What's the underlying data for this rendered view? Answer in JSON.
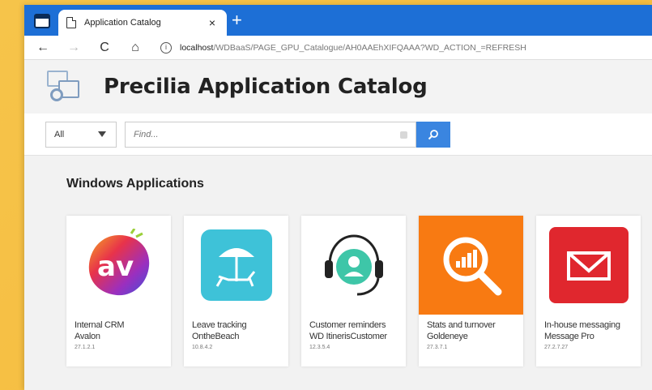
{
  "tab": {
    "title": "Application Catalog",
    "close": "×",
    "new": "+"
  },
  "toolbar": {
    "back": "←",
    "forward": "→",
    "reload": "C",
    "home": "⌂",
    "info": "i",
    "url_host": "localhost",
    "url_path": "/WDBaaS/PAGE_GPU_Catalogue/AH0AAEhXIFQAAA?WD_ACTION_=REFRESH"
  },
  "header": {
    "title": "Precilia Application Catalog"
  },
  "search": {
    "category": "All",
    "placeholder": "Find..."
  },
  "section": {
    "title": "Windows Applications"
  },
  "apps": [
    {
      "name1": "Internal CRM",
      "name2": "Avalon",
      "version": "27.1.2.1",
      "icon": "avalon-logo-icon"
    },
    {
      "name1": "Leave tracking",
      "name2": "OntheBeach",
      "version": "10.8.4.2",
      "icon": "beach-umbrella-icon"
    },
    {
      "name1": "Customer reminders",
      "name2": "WD ItinerisCustomer",
      "version": "12.3.5.4",
      "icon": "headset-support-icon"
    },
    {
      "name1": "Stats and turnover",
      "name2": "Goldeneye",
      "version": "27.3.7.1",
      "icon": "magnifier-chart-icon"
    },
    {
      "name1": "In-house messaging",
      "name2": "Message Pro",
      "version": "27.2.7.27",
      "icon": "envelope-icon"
    }
  ],
  "colors": {
    "browser_blue": "#1d6fd6",
    "search_blue": "#3a85e0",
    "orange": "#f87a12",
    "red": "#e0272e",
    "teal": "#3ec2d8"
  }
}
